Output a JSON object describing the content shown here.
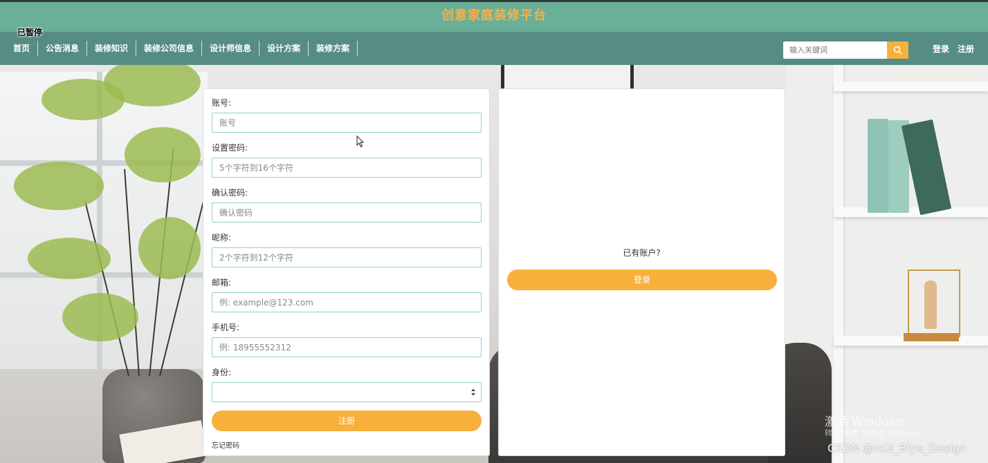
{
  "header": {
    "title": "创意家庭装修平台",
    "paused_label": "已暂停"
  },
  "nav": {
    "items": [
      {
        "label": "首页"
      },
      {
        "label": "公告消息"
      },
      {
        "label": "装修知识"
      },
      {
        "label": "装修公司信息"
      },
      {
        "label": "设计师信息"
      },
      {
        "label": "设计方案"
      },
      {
        "label": "装修方案"
      }
    ],
    "search": {
      "placeholder": "输入关键词",
      "icon": "search-icon"
    },
    "login": "登录",
    "register": "注册"
  },
  "register_form": {
    "fields": [
      {
        "label": "账号:",
        "placeholder": "账号",
        "value": ""
      },
      {
        "label": "设置密码:",
        "placeholder": "5个字符到16个字符",
        "value": ""
      },
      {
        "label": "确认密码:",
        "placeholder": "确认密码",
        "value": ""
      },
      {
        "label": "昵称:",
        "placeholder": "2个字符到12个字符",
        "value": ""
      },
      {
        "label": "邮箱:",
        "placeholder": "例: example@123.com",
        "value": ""
      },
      {
        "label": "手机号:",
        "placeholder": "例: 18955552312",
        "value": ""
      }
    ],
    "identity": {
      "label": "身份:",
      "selected": ""
    },
    "submit": "注册",
    "forgot": "忘记密码"
  },
  "login_panel": {
    "prompt": "已有账户?",
    "button": "登录"
  },
  "watermarks": {
    "windows_activate": "激活 Windows",
    "windows_sub": "转到\"设置\"以激活 Windows。",
    "csdn": "CSDN @vx2_Biye_Design"
  },
  "colors": {
    "title_bar": "#6aaf97",
    "nav_bar": "#558c84",
    "accent": "#f7b03c",
    "title_text": "#f5b14b",
    "input_border": "#8fd1c7"
  }
}
